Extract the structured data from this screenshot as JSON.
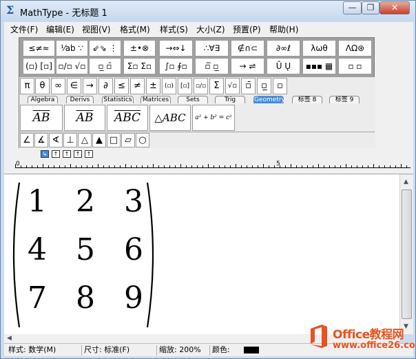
{
  "window": {
    "title": "MathType - 无标题 1",
    "app_icon": "Σ",
    "minimize": "—",
    "restore": "❐",
    "close": "✕"
  },
  "menu": [
    "文件(F)",
    "编辑(E)",
    "视图(V)",
    "格式(M)",
    "样式(S)",
    "大小(Z)",
    "预置(P)",
    "帮助(H)"
  ],
  "symbol_row1": [
    "≤≠≈",
    "⅟ab ∵",
    "⇙⇘ ⋮",
    "±•⊗",
    "→⇔↓",
    "∴∀∃",
    "∉∩⊂",
    "∂∞ℓ",
    "λωθ",
    "ΛΩ⊛"
  ],
  "symbol_row2": [
    "(▫) [▫]",
    "▫/▫ √▫",
    "▫̲ ▫̄",
    "Σ▫ Σ▫",
    "∫▫ ∮▫",
    "▫̅ ▫̲",
    "→ ⇌",
    "Ū Ų",
    "▪▪▪ ▦",
    "▫ ▫"
  ],
  "small_row": [
    "π",
    "θ",
    "∞",
    "∈",
    "→",
    "∂",
    "≤",
    "≠",
    "±",
    "(▫)",
    "[▫]",
    "▫/▫",
    "Σ",
    "√▫",
    "▫̄",
    "▫̲",
    "▫"
  ],
  "tabs": [
    "Algebra",
    "Derivs",
    "Statistics",
    "Matrices",
    "Sets",
    "Trig",
    "Geometry",
    "标签 8",
    "标签 9"
  ],
  "active_tab": "Geometry",
  "templates": [
    "AB",
    "AB",
    "ABC",
    "△ABC",
    "a² + b² = c²"
  ],
  "geometry_row": [
    "∠",
    "∡",
    "∢",
    "⊥",
    "△",
    "▲",
    "□",
    "▱",
    "○"
  ],
  "tabstop_buttons": [
    "↳",
    "↑",
    "↑",
    "↑",
    "↑"
  ],
  "ruler": {
    "mark0": "0",
    "mark5": "5"
  },
  "matrix": {
    "rows": [
      [
        "1",
        "2",
        "3"
      ],
      [
        "4",
        "5",
        "6"
      ],
      [
        "7",
        "8",
        "9"
      ]
    ]
  },
  "status": {
    "style": "样式: 数学(M)",
    "size": "尺寸: 标准(F)",
    "zoom": "缩放: 200%",
    "color_label": "颜色:",
    "color_value": "#000000"
  },
  "watermark": {
    "title": "Office教程网",
    "url": "www.office26.com",
    "brand_color": "#e8531e"
  }
}
